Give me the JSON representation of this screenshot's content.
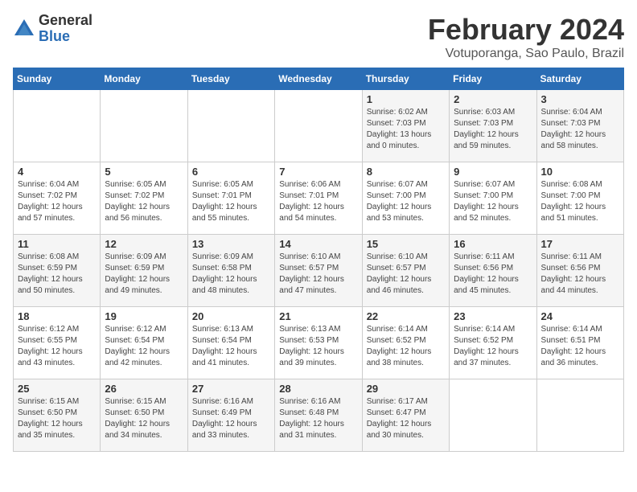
{
  "logo": {
    "general": "General",
    "blue": "Blue"
  },
  "title": "February 2024",
  "subtitle": "Votuporanga, Sao Paulo, Brazil",
  "weekdays": [
    "Sunday",
    "Monday",
    "Tuesday",
    "Wednesday",
    "Thursday",
    "Friday",
    "Saturday"
  ],
  "weeks": [
    [
      {
        "day": "",
        "info": ""
      },
      {
        "day": "",
        "info": ""
      },
      {
        "day": "",
        "info": ""
      },
      {
        "day": "",
        "info": ""
      },
      {
        "day": "1",
        "info": "Sunrise: 6:02 AM\nSunset: 7:03 PM\nDaylight: 13 hours\nand 0 minutes."
      },
      {
        "day": "2",
        "info": "Sunrise: 6:03 AM\nSunset: 7:03 PM\nDaylight: 12 hours\nand 59 minutes."
      },
      {
        "day": "3",
        "info": "Sunrise: 6:04 AM\nSunset: 7:03 PM\nDaylight: 12 hours\nand 58 minutes."
      }
    ],
    [
      {
        "day": "4",
        "info": "Sunrise: 6:04 AM\nSunset: 7:02 PM\nDaylight: 12 hours\nand 57 minutes."
      },
      {
        "day": "5",
        "info": "Sunrise: 6:05 AM\nSunset: 7:02 PM\nDaylight: 12 hours\nand 56 minutes."
      },
      {
        "day": "6",
        "info": "Sunrise: 6:05 AM\nSunset: 7:01 PM\nDaylight: 12 hours\nand 55 minutes."
      },
      {
        "day": "7",
        "info": "Sunrise: 6:06 AM\nSunset: 7:01 PM\nDaylight: 12 hours\nand 54 minutes."
      },
      {
        "day": "8",
        "info": "Sunrise: 6:07 AM\nSunset: 7:00 PM\nDaylight: 12 hours\nand 53 minutes."
      },
      {
        "day": "9",
        "info": "Sunrise: 6:07 AM\nSunset: 7:00 PM\nDaylight: 12 hours\nand 52 minutes."
      },
      {
        "day": "10",
        "info": "Sunrise: 6:08 AM\nSunset: 7:00 PM\nDaylight: 12 hours\nand 51 minutes."
      }
    ],
    [
      {
        "day": "11",
        "info": "Sunrise: 6:08 AM\nSunset: 6:59 PM\nDaylight: 12 hours\nand 50 minutes."
      },
      {
        "day": "12",
        "info": "Sunrise: 6:09 AM\nSunset: 6:59 PM\nDaylight: 12 hours\nand 49 minutes."
      },
      {
        "day": "13",
        "info": "Sunrise: 6:09 AM\nSunset: 6:58 PM\nDaylight: 12 hours\nand 48 minutes."
      },
      {
        "day": "14",
        "info": "Sunrise: 6:10 AM\nSunset: 6:57 PM\nDaylight: 12 hours\nand 47 minutes."
      },
      {
        "day": "15",
        "info": "Sunrise: 6:10 AM\nSunset: 6:57 PM\nDaylight: 12 hours\nand 46 minutes."
      },
      {
        "day": "16",
        "info": "Sunrise: 6:11 AM\nSunset: 6:56 PM\nDaylight: 12 hours\nand 45 minutes."
      },
      {
        "day": "17",
        "info": "Sunrise: 6:11 AM\nSunset: 6:56 PM\nDaylight: 12 hours\nand 44 minutes."
      }
    ],
    [
      {
        "day": "18",
        "info": "Sunrise: 6:12 AM\nSunset: 6:55 PM\nDaylight: 12 hours\nand 43 minutes."
      },
      {
        "day": "19",
        "info": "Sunrise: 6:12 AM\nSunset: 6:54 PM\nDaylight: 12 hours\nand 42 minutes."
      },
      {
        "day": "20",
        "info": "Sunrise: 6:13 AM\nSunset: 6:54 PM\nDaylight: 12 hours\nand 41 minutes."
      },
      {
        "day": "21",
        "info": "Sunrise: 6:13 AM\nSunset: 6:53 PM\nDaylight: 12 hours\nand 39 minutes."
      },
      {
        "day": "22",
        "info": "Sunrise: 6:14 AM\nSunset: 6:52 PM\nDaylight: 12 hours\nand 38 minutes."
      },
      {
        "day": "23",
        "info": "Sunrise: 6:14 AM\nSunset: 6:52 PM\nDaylight: 12 hours\nand 37 minutes."
      },
      {
        "day": "24",
        "info": "Sunrise: 6:14 AM\nSunset: 6:51 PM\nDaylight: 12 hours\nand 36 minutes."
      }
    ],
    [
      {
        "day": "25",
        "info": "Sunrise: 6:15 AM\nSunset: 6:50 PM\nDaylight: 12 hours\nand 35 minutes."
      },
      {
        "day": "26",
        "info": "Sunrise: 6:15 AM\nSunset: 6:50 PM\nDaylight: 12 hours\nand 34 minutes."
      },
      {
        "day": "27",
        "info": "Sunrise: 6:16 AM\nSunset: 6:49 PM\nDaylight: 12 hours\nand 33 minutes."
      },
      {
        "day": "28",
        "info": "Sunrise: 6:16 AM\nSunset: 6:48 PM\nDaylight: 12 hours\nand 31 minutes."
      },
      {
        "day": "29",
        "info": "Sunrise: 6:17 AM\nSunset: 6:47 PM\nDaylight: 12 hours\nand 30 minutes."
      },
      {
        "day": "",
        "info": ""
      },
      {
        "day": "",
        "info": ""
      }
    ]
  ]
}
